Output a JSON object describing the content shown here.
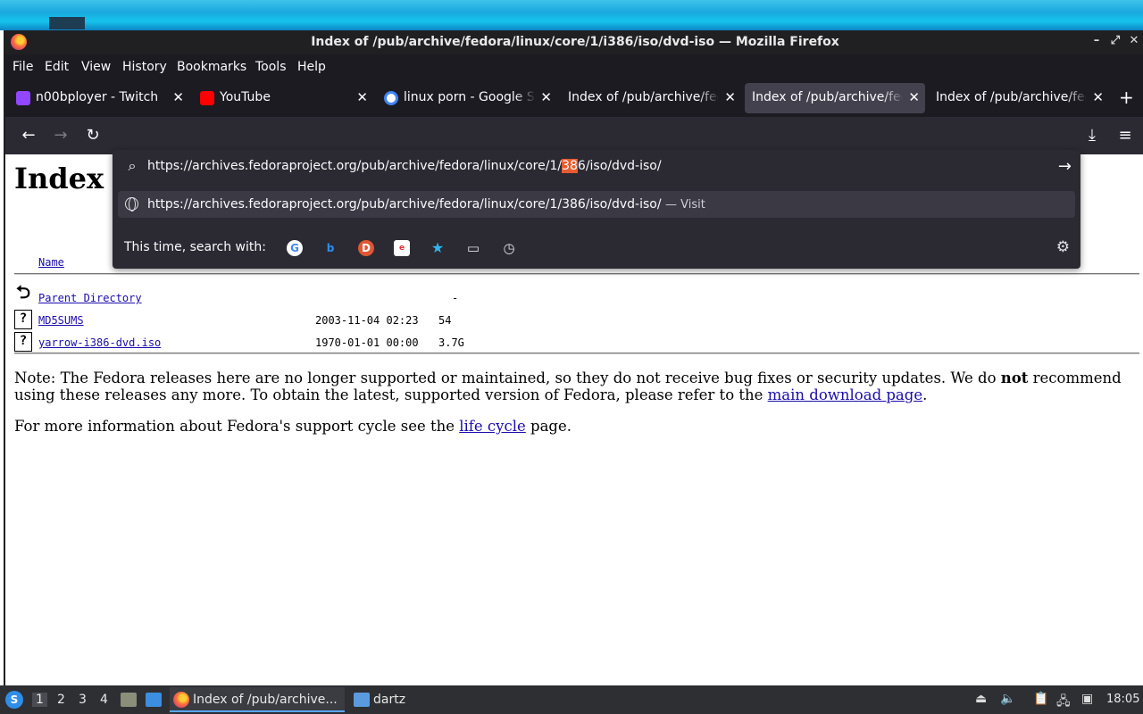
{
  "window": {
    "title": "Index of /pub/archive/fedora/linux/core/1/i386/iso/dvd-iso — Mozilla Firefox"
  },
  "menu": [
    "File",
    "Edit",
    "View",
    "History",
    "Bookmarks",
    "Tools",
    "Help"
  ],
  "tabs": [
    {
      "label": "n00bployer - Twitch",
      "icon": "twitch-icon",
      "color": "#9146ff"
    },
    {
      "label": "YouTube",
      "icon": "youtube-icon",
      "color": "#ff0000"
    },
    {
      "label": "linux porn - Google Se",
      "icon": "google-icon",
      "color": "#ffffff"
    },
    {
      "label": "Index of /pub/archive/fed",
      "icon": "",
      "color": ""
    },
    {
      "label": "Index of /pub/archive/fed",
      "icon": "",
      "color": "",
      "active": true
    },
    {
      "label": "Index of /pub/archive/fed",
      "icon": "",
      "color": ""
    }
  ],
  "urlbar": {
    "value_before": "https://archives.fedoraproject.org/pub/archive/fedora/linux/core/1/",
    "value_highlight": "38",
    "value_after": "6/iso/dvd-iso/",
    "suggestion_url": "https://archives.fedoraproject.org/pub/archive/fedora/linux/core/1/386/iso/dvd-iso/",
    "suggestion_action": "— Visit",
    "search_with_label": "This time, search with:",
    "engines": [
      {
        "name": "google-engine-icon",
        "glyph": "G",
        "color": "#4285f4"
      },
      {
        "name": "bing-engine-icon",
        "glyph": "b",
        "color": "#2b8ef0"
      },
      {
        "name": "duckduckgo-engine-icon",
        "glyph": "D",
        "color": "#de5833"
      },
      {
        "name": "ebay-engine-icon",
        "glyph": "e",
        "color": "#e53238"
      },
      {
        "name": "bookmarks-engine-icon",
        "glyph": "★",
        "color": "#31b5f0"
      },
      {
        "name": "tabs-engine-icon",
        "glyph": "▭",
        "color": "#e0e0e6"
      },
      {
        "name": "history-engine-icon",
        "glyph": "◷",
        "color": "#e0e0e6"
      }
    ]
  },
  "page": {
    "heading": "Index",
    "column_name": "Name",
    "rows": [
      {
        "name": "Parent Directory",
        "date": "",
        "size": "-",
        "icon": "back"
      },
      {
        "name": "MD5SUMS",
        "date": "2003-11-04 02:23",
        "size": "54",
        "icon": "unknown"
      },
      {
        "name": "yarrow-i386-dvd.iso",
        "date": "1970-01-01 00:00",
        "size": "3.7G",
        "icon": "unknown"
      }
    ],
    "note_part1": "Note: The Fedora releases here are no longer supported or maintained, so they do not receive bug fixes or security updates. We do ",
    "note_bold": "not",
    "note_part2": " recommend using these releases any more. To obtain the latest, supported version of Fedora, please refer to the ",
    "note_link": "main download page",
    "note_end": ".",
    "lifecycle_part1": "For more information about Fedora's support cycle see the ",
    "lifecycle_link": "life cycle",
    "lifecycle_part2": " page."
  },
  "taskbar": {
    "workspaces": [
      "1",
      "2",
      "3",
      "4"
    ],
    "tasks": [
      {
        "label": "Index of /pub/archive...",
        "active": true
      },
      {
        "label": "dartz",
        "active": false
      }
    ],
    "clock": "18:05"
  }
}
